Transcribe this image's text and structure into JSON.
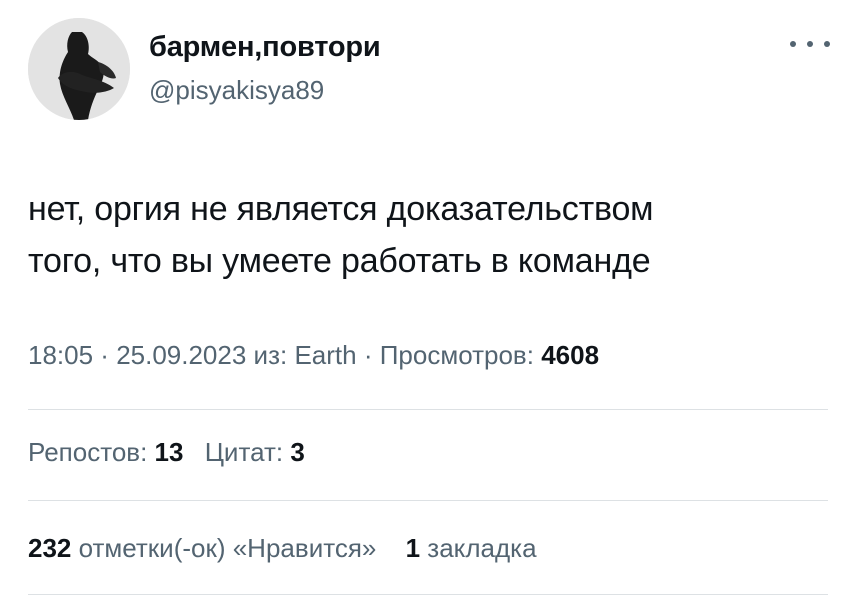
{
  "user": {
    "display_name": "бармен,повтори",
    "handle": "@pisyakisya89"
  },
  "tweet": {
    "text_lines": [
      "нет, оргия не является доказательством",
      "того, что вы умеете работать в команде"
    ],
    "time": "18:05",
    "separator": " · ",
    "date": "25.09.2023",
    "source_prefix": " из: ",
    "source": "Earth",
    "views_label": "Просмотров: ",
    "views_count": "4608"
  },
  "stats": {
    "reposts_label": "Репостов: ",
    "reposts_count": "13",
    "quotes_label": "Цитат: ",
    "quotes_count": "3",
    "likes_count": "232",
    "likes_label": " отметки(-ок) «Нравится»",
    "bookmarks_count": "1",
    "bookmarks_label": " закладка"
  },
  "icons": {
    "more": "more-horizontal-icon"
  },
  "colors": {
    "text_primary": "#0f1419",
    "text_secondary": "#536471",
    "divider": "#dde1e4"
  }
}
